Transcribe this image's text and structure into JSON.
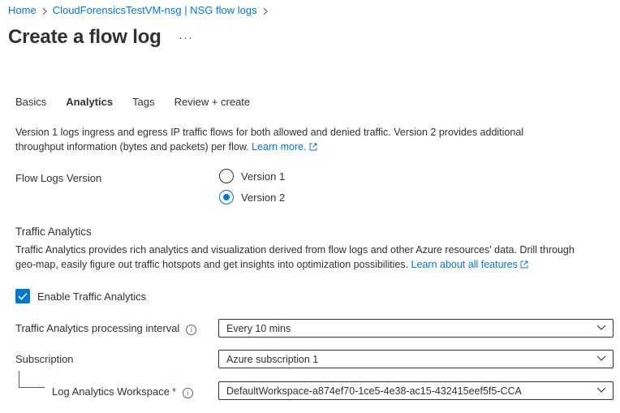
{
  "breadcrumb": [
    {
      "label": "Home"
    },
    {
      "label": "CloudForensicsTestVM-nsg | NSG flow logs"
    }
  ],
  "page": {
    "title": "Create a flow log",
    "more_label": "···"
  },
  "tabs": [
    {
      "label": "Basics",
      "active": false
    },
    {
      "label": "Analytics",
      "active": true
    },
    {
      "label": "Tags",
      "active": false
    },
    {
      "label": "Review + create",
      "active": false
    }
  ],
  "version_section": {
    "description_line1": "Version 1 logs ingress and egress IP traffic flows for both allowed and denied traffic. Version 2 provides additional",
    "description_line2": "throughput information (bytes and packets) per flow.",
    "learn_more": "Learn more.",
    "label": "Flow Logs Version",
    "options": [
      {
        "label": "Version 1",
        "selected": false
      },
      {
        "label": "Version 2",
        "selected": true
      }
    ]
  },
  "traffic_analytics": {
    "title": "Traffic Analytics",
    "description_line1": "Traffic Analytics provides rich analytics and visualization derived from flow logs and other Azure resources' data. Drill through",
    "description_line2": "geo-map, easily figure out traffic hotspots and get insights into optimization possibilities.",
    "learn_link": "Learn about all features",
    "enable_label": "Enable Traffic Analytics",
    "enabled": true,
    "interval_label": "Traffic Analytics processing interval",
    "interval_value": "Every 10 mins",
    "subscription_label": "Subscription",
    "subscription_value": "Azure subscription 1",
    "workspace_label": "Log Analytics Workspace",
    "workspace_required": "*",
    "workspace_value": "DefaultWorkspace-a874ef70-1ce5-4e38-ac15-432415eef5f5-CCA"
  },
  "colors": {
    "accent": "#0078d4",
    "text": "#323130",
    "required": "#a4262c"
  }
}
